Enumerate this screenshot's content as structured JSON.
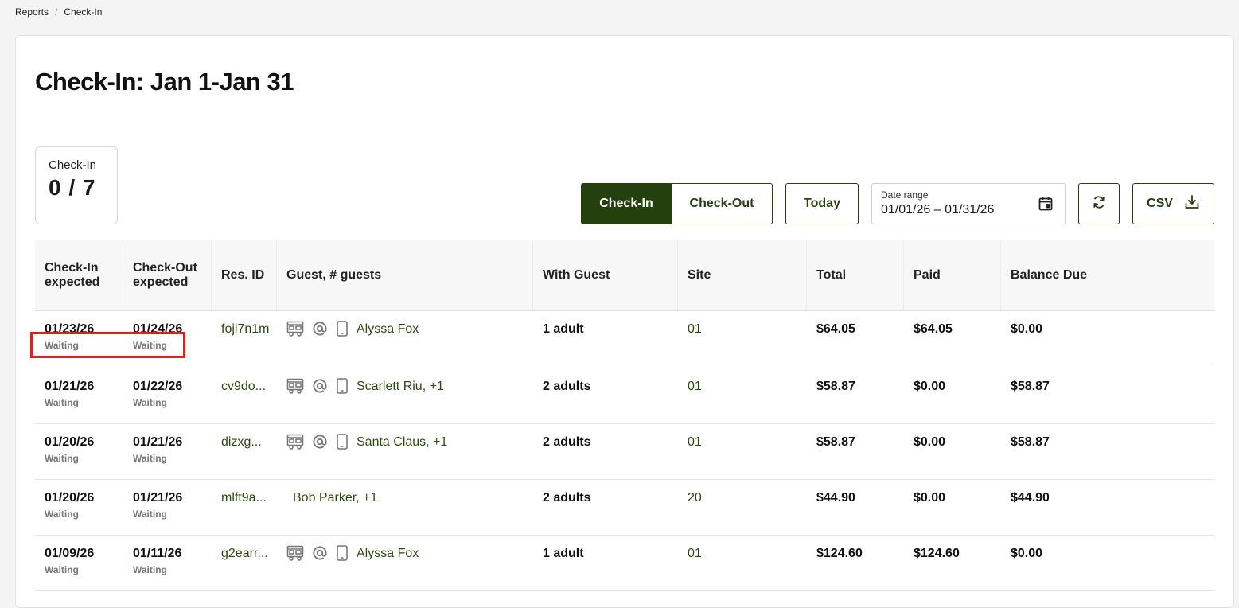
{
  "breadcrumb": {
    "items": [
      "Reports",
      "Check-In"
    ],
    "separator": "/"
  },
  "page_title": "Check-In: Jan 1-Jan 31",
  "stat": {
    "label": "Check-In",
    "value": "0 / 7"
  },
  "toolbar": {
    "checkin_label": "Check-In",
    "checkout_label": "Check-Out",
    "today_label": "Today",
    "date_range_label": "Date range",
    "date_range_value": "01/01/26 – 01/31/26",
    "csv_label": "CSV"
  },
  "table": {
    "headers": {
      "checkin": "Check-In expected",
      "checkout": "Check-Out expected",
      "res_id": "Res. ID",
      "guest": "Guest, # guests",
      "with_guest": "With Guest",
      "site": "Site",
      "total": "Total",
      "paid": "Paid",
      "balance": "Balance Due"
    },
    "rows": [
      {
        "checkin": "01/23/26",
        "checkin_status": "Waiting",
        "checkout": "01/24/26",
        "checkout_status": "Waiting",
        "res_id": "fojl7n1m",
        "guest": "Alyssa Fox",
        "with_guest": "1 adult",
        "site": "01",
        "total": "$64.05",
        "paid": "$64.05",
        "balance": "$0.00"
      },
      {
        "checkin": "01/21/26",
        "checkin_status": "Waiting",
        "checkout": "01/22/26",
        "checkout_status": "Waiting",
        "res_id": "cv9do...",
        "guest": "Scarlett Riu, +1",
        "with_guest": "2 adults",
        "site": "01",
        "total": "$58.87",
        "paid": "$0.00",
        "balance": "$58.87"
      },
      {
        "checkin": "01/20/26",
        "checkin_status": "Waiting",
        "checkout": "01/21/26",
        "checkout_status": "Waiting",
        "res_id": "dizxg...",
        "guest": "Santa Claus, +1",
        "with_guest": "2 adults",
        "site": "01",
        "total": "$58.87",
        "paid": "$0.00",
        "balance": "$58.87"
      },
      {
        "checkin": "01/20/26",
        "checkin_status": "Waiting",
        "checkout": "01/21/26",
        "checkout_status": "Waiting",
        "res_id": "mlft9a...",
        "guest": "Bob Parker, +1",
        "with_guest": "2 adults",
        "site": "20",
        "total": "$44.90",
        "paid": "$0.00",
        "balance": "$44.90"
      },
      {
        "checkin": "01/09/26",
        "checkin_status": "Waiting",
        "checkout": "01/11/26",
        "checkout_status": "Waiting",
        "res_id": "g2earr...",
        "guest": "Alyssa Fox",
        "with_guest": "1 adult",
        "site": "01",
        "total": "$124.60",
        "paid": "$124.60",
        "balance": "$0.00"
      }
    ]
  },
  "colors": {
    "accent": "#24410d",
    "link_green": "#2e4a13",
    "highlight": "#e02020"
  }
}
